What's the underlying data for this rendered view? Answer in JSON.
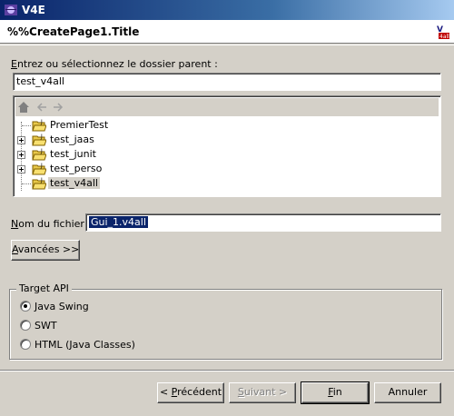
{
  "window": {
    "title": "V4E"
  },
  "header": {
    "page_title": "%%CreatePage1.Title"
  },
  "parent_folder": {
    "label_first": "E",
    "label_rest": "ntrez ou sélectionnez le dossier parent :",
    "value": "test_v4all"
  },
  "tree": {
    "items": [
      {
        "label": "PremierTest"
      },
      {
        "label": "test_jaas"
      },
      {
        "label": "test_junit"
      },
      {
        "label": "test_perso"
      },
      {
        "label": "test_v4all"
      }
    ]
  },
  "file_name": {
    "label_first": "N",
    "label_rest": "om du fichier :",
    "value": "Gui_1.v4all"
  },
  "advanced_button": {
    "label_first": "A",
    "label_rest": "vancées >>"
  },
  "target_api": {
    "title": "Target API",
    "options": [
      {
        "label": "Java Swing",
        "checked": true
      },
      {
        "label": "SWT",
        "checked": false
      },
      {
        "label": "HTML (Java Classes)",
        "checked": false
      }
    ]
  },
  "footer": {
    "back_prefix": "< ",
    "back_first": "P",
    "back_rest": "récédent",
    "next_first": "S",
    "next_rest": "uivant >",
    "finish_first": "F",
    "finish_rest": "in",
    "cancel": "Annuler"
  }
}
